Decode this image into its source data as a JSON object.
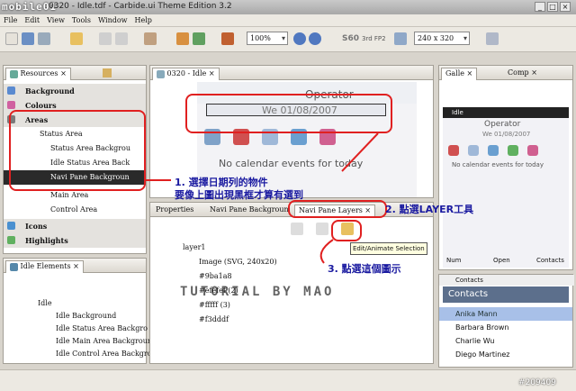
{
  "window": {
    "title": "0320 - Idle.tdf - Carbide.ui Theme Edition 3.2",
    "logo": "mobile01",
    "min": "_",
    "max": "□",
    "close": "×"
  },
  "menu": [
    "File",
    "Edit",
    "View",
    "Tools",
    "Window",
    "Help"
  ],
  "toolbar": {
    "zoom": "100%",
    "device": "S60",
    "fp": "3rd FP2",
    "resolution": "240 x 320"
  },
  "resources": {
    "tab": "Resources",
    "items": [
      {
        "label": "Background",
        "bold": true
      },
      {
        "label": "Colours",
        "bold": true
      },
      {
        "label": "Areas",
        "bold": true
      },
      {
        "label": "Status Area"
      },
      {
        "label": "Status Area Backgrou"
      },
      {
        "label": "Idle Status Area Back"
      },
      {
        "label": "Navi Pane Backgroun"
      },
      {
        "label": "Main Area"
      },
      {
        "label": "Control Area"
      },
      {
        "label": "Icons",
        "bold": true
      },
      {
        "label": "Highlights",
        "bold": true
      }
    ]
  },
  "idle_elements": {
    "tab": "Idle Elements",
    "items": [
      "Idle",
      "Idle Background",
      "Idle Status Area Backgro",
      "Idle Main Area Backgroun",
      "Idle Control Area Backgro"
    ]
  },
  "editor": {
    "tab": "0320 - Idle",
    "operator": "Operator",
    "date": "We 01/08/2007",
    "no_events": "No calendar events for today"
  },
  "bottom": {
    "tabs": [
      "Properties",
      "Navi Pane Backgroun",
      "Navi Pane Layers"
    ],
    "tooltip": "Edit/Animate Selection",
    "layers": [
      {
        "label": "layer1"
      },
      {
        "label": "Image (SVG, 240x20)"
      },
      {
        "label": "#9ba1a8"
      },
      {
        "label": "#efefef (2)"
      },
      {
        "label": "#fffff (3)"
      },
      {
        "label": "#f3dddf"
      }
    ]
  },
  "gallery": {
    "tab": "Galle",
    "tab2": "Comp",
    "idle_label": "Idle",
    "operator": "Operator",
    "date": "We 01/08/2007",
    "no_events": "No calendar events for today",
    "softkeys": [
      "Num",
      "Open",
      "Contacts"
    ]
  },
  "contacts": {
    "label": "Contacts",
    "title": "Contacts",
    "items": [
      "Anika Mann",
      "Barbara Brown",
      "Charlie Wu",
      "Diego Martinez"
    ]
  },
  "annotations": {
    "a1_line1": "1. 選擇日期列的物件",
    "a1_line2": "要像上圖出現黑框才算有選到",
    "a2": "2. 點選LAYER工具",
    "a3": "3. 點選這個圖示",
    "watermark": "TUTORIAL BY MAO",
    "id": "#209409"
  }
}
